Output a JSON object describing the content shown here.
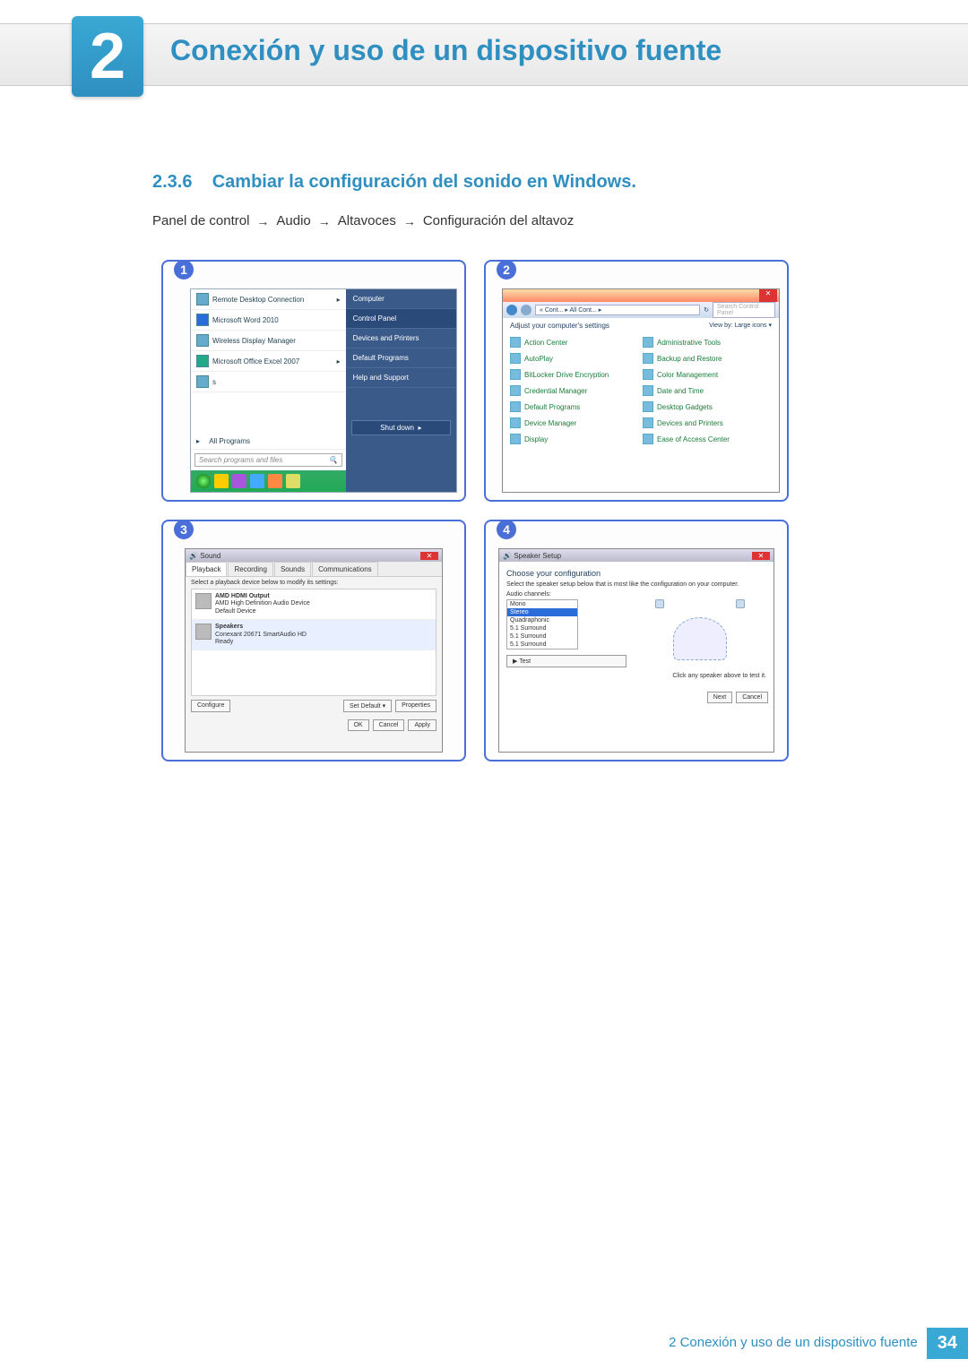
{
  "chapter": {
    "number": "2",
    "title": "Conexión y uso de un dispositivo fuente"
  },
  "section": {
    "number": "2.3.6",
    "title": "Cambiar la configuración del sonido en Windows."
  },
  "path": {
    "p1": "Panel de control",
    "p2": "Audio",
    "p3": "Altavoces",
    "p4": "Configuración del altavoz",
    "arrow": "→"
  },
  "panel1": {
    "badge": "1",
    "left_items": [
      "Remote Desktop Connection",
      "Microsoft Word 2010",
      "Wireless Display Manager",
      "Microsoft Office Excel 2007",
      "s"
    ],
    "all_programs": "All Programs",
    "search_placeholder": "Search programs and files",
    "right_items": {
      "computer": "Computer",
      "control_panel": "Control Panel",
      "devices": "Devices and Printers",
      "default": "Default Programs",
      "help": "Help and Support"
    },
    "shutdown": "Shut down"
  },
  "panel2": {
    "badge": "2",
    "crumb": "« Cont... ▸ All Cont... ▸",
    "search_placeholder": "Search Control Panel",
    "heading": "Adjust your computer's settings",
    "viewby": "View by:   Large icons ▾",
    "items_left": [
      "Action Center",
      "AutoPlay",
      "BitLocker Drive Encryption",
      "Credential Manager",
      "Default Programs",
      "Device Manager",
      "Display"
    ],
    "items_right": [
      "Administrative Tools",
      "Backup and Restore",
      "Color Management",
      "Date and Time",
      "Desktop Gadgets",
      "Devices and Printers",
      "Ease of Access Center"
    ]
  },
  "panel3": {
    "badge": "3",
    "title": "Sound",
    "tabs": {
      "playback": "Playback",
      "recording": "Recording",
      "sounds": "Sounds",
      "comm": "Communications"
    },
    "instruction": "Select a playback device below to modify its settings:",
    "dev1": {
      "name": "AMD HDMI Output",
      "desc": "AMD High Definition Audio Device",
      "status": "Default Device"
    },
    "dev2": {
      "name": "Speakers",
      "desc": "Conexant 20671 SmartAudio HD",
      "status": "Ready"
    },
    "buttons": {
      "configure": "Configure",
      "setdefault": "Set Default ▾",
      "properties": "Properties",
      "ok": "OK",
      "cancel": "Cancel",
      "apply": "Apply"
    }
  },
  "panel4": {
    "badge": "4",
    "title": "Speaker Setup",
    "heading": "Choose your configuration",
    "sub": "Select the speaker setup below that is most like the configuration on your computer.",
    "label": "Audio channels:",
    "options": [
      "Mono",
      "Stereo",
      "Quadraphonic",
      "5.1 Surround",
      "5.1 Surround",
      "5.1 Surround"
    ],
    "test": "▶ Test",
    "note": "Click any speaker above to test it.",
    "next": "Next",
    "cancel": "Cancel"
  },
  "footer": {
    "text": "2 Conexión y uso de un dispositivo fuente",
    "page": "34"
  }
}
